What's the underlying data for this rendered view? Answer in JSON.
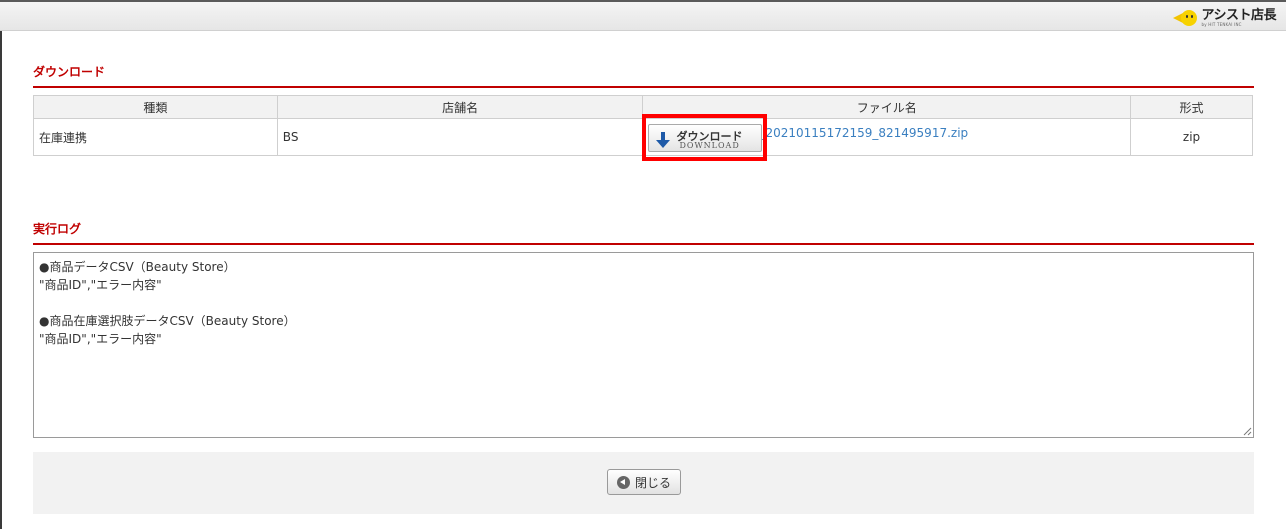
{
  "app": {
    "logo_text": "アシスト店長",
    "logo_sub": "by HIT TENKAI INC"
  },
  "download_section": {
    "title": "ダウンロード",
    "columns": [
      "種類",
      "店舗名",
      "ファイル名",
      "形式"
    ],
    "rows": [
      {
        "type": "在庫連携",
        "store": "BS",
        "file_name": "_20210115172159_821495917.zip",
        "format": "zip"
      }
    ],
    "button": {
      "label_jp": "ダウンロード",
      "label_en": "DOWNLOAD"
    }
  },
  "log_section": {
    "title": "実行ログ",
    "content": "●商品データCSV（Beauty Store）\n\"商品ID\",\"エラー内容\"\n\n●商品在庫選択肢データCSV（Beauty Store）\n\"商品ID\",\"エラー内容\""
  },
  "footer": {
    "close_label": "閉じる"
  },
  "colors": {
    "accent": "#c00000",
    "link": "#3a7fc0",
    "highlight": "#ff0000",
    "download_arrow": "#1e5aa8"
  }
}
